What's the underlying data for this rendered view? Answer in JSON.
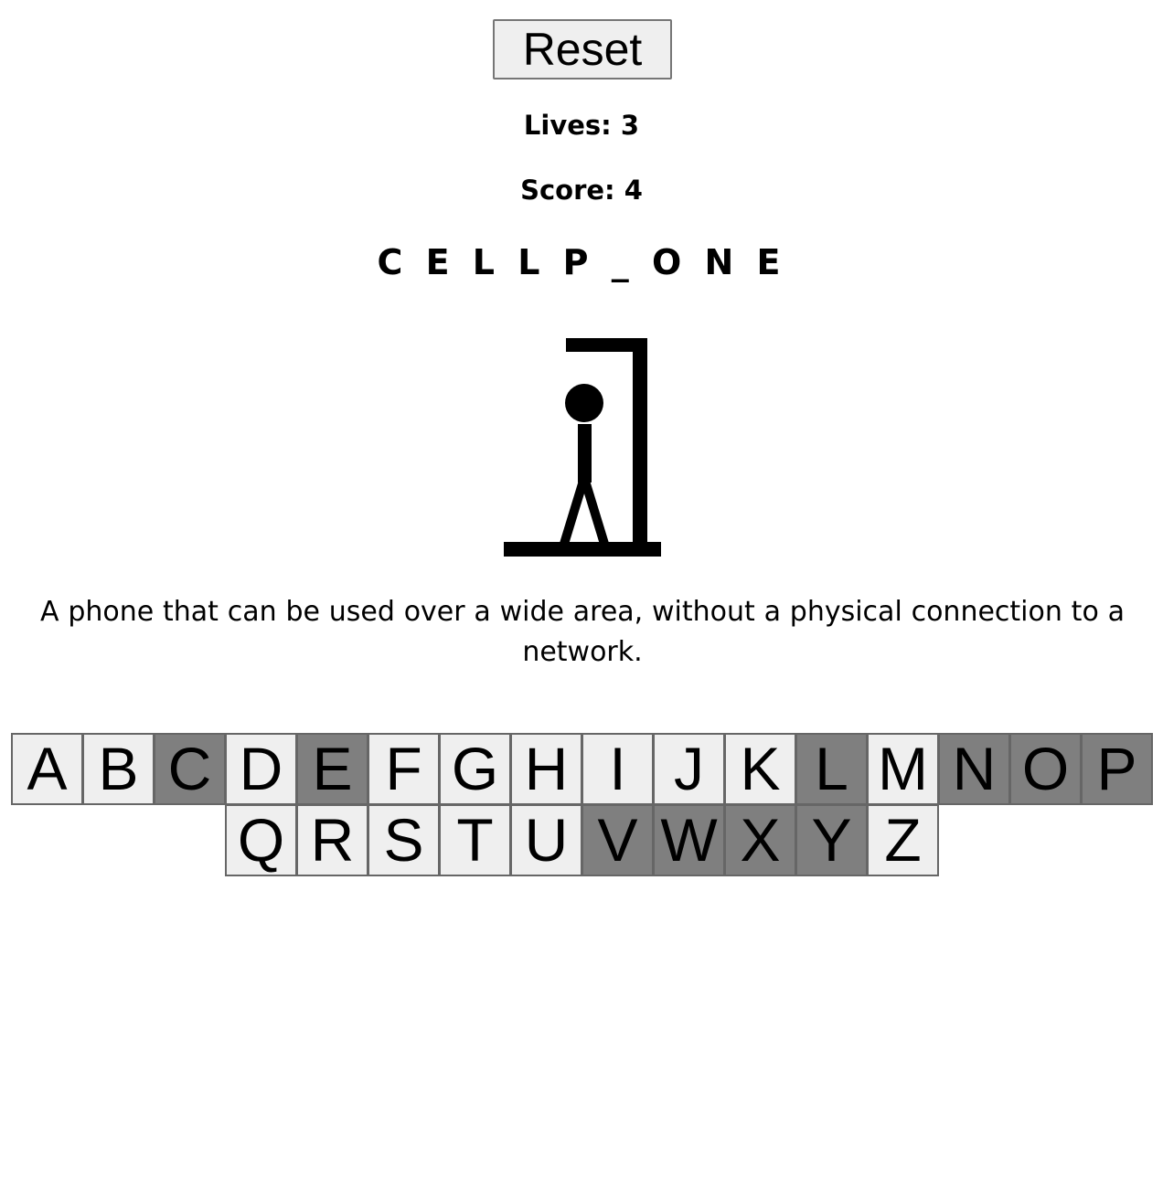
{
  "reset_label": "Reset",
  "lives": {
    "label": "Lives:",
    "value": "3"
  },
  "score": {
    "label": "Score: ",
    "value": "4"
  },
  "word": "CELLP_ONE",
  "hint": "A phone that can be used over a wide area, without a physical connection to a network.",
  "colors": {
    "key_available": "#efefef",
    "key_used": "#7f7f7f"
  },
  "keyboard": {
    "rows": [
      [
        {
          "letter": "A",
          "used": false
        },
        {
          "letter": "B",
          "used": false
        },
        {
          "letter": "C",
          "used": true
        },
        {
          "letter": "D",
          "used": false
        },
        {
          "letter": "E",
          "used": true
        },
        {
          "letter": "F",
          "used": false
        },
        {
          "letter": "G",
          "used": false
        },
        {
          "letter": "H",
          "used": false
        },
        {
          "letter": "I",
          "used": false
        },
        {
          "letter": "J",
          "used": false
        },
        {
          "letter": "K",
          "used": false
        },
        {
          "letter": "L",
          "used": true
        },
        {
          "letter": "M",
          "used": false
        },
        {
          "letter": "N",
          "used": true
        },
        {
          "letter": "O",
          "used": true
        },
        {
          "letter": "P",
          "used": true
        }
      ],
      [
        {
          "letter": "Q",
          "used": false
        },
        {
          "letter": "R",
          "used": false
        },
        {
          "letter": "S",
          "used": false
        },
        {
          "letter": "T",
          "used": false
        },
        {
          "letter": "U",
          "used": false
        },
        {
          "letter": "V",
          "used": true
        },
        {
          "letter": "W",
          "used": true
        },
        {
          "letter": "X",
          "used": true
        },
        {
          "letter": "Y",
          "used": true
        },
        {
          "letter": "Z",
          "used": false
        }
      ]
    ]
  }
}
